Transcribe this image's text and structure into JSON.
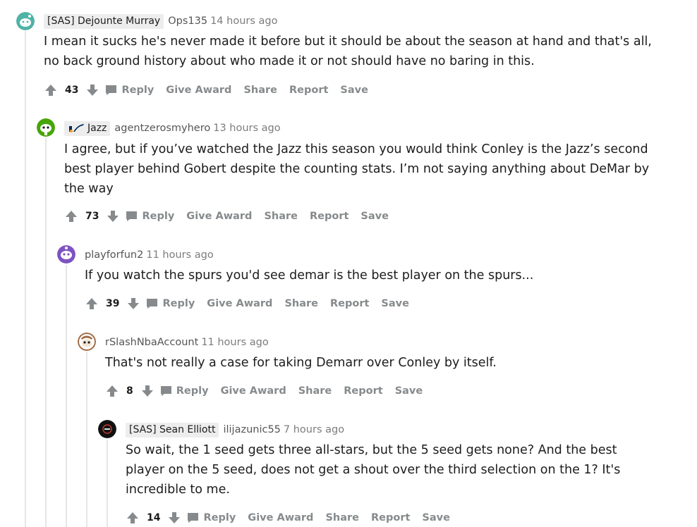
{
  "comments": [
    {
      "flair": "[SAS] Dejounte Murray",
      "username": "Ops135",
      "time": "14 hours ago",
      "body": "I mean it sucks he's never made it before but it should be about the season at hand and that's all, no back ground history about who made it or not should have no baring in this.",
      "score": "43"
    },
    {
      "flair": "Jazz",
      "username": "agentzerosmyhero",
      "time": "13 hours ago",
      "body": "I agree, but if you’ve watched the Jazz this season you would think Conley is the Jazz’s second best player behind Gobert despite the counting stats. I’m not saying anything about DeMar by the way",
      "score": "73"
    },
    {
      "username": "playforfun2",
      "time": "11 hours ago",
      "body": "If you watch the spurs you'd see demar is the best player on the spurs...",
      "score": "39"
    },
    {
      "username": "rSlashNbaAccount",
      "time": "11 hours ago",
      "body": "That's not really a case for taking Demarr over Conley by itself.",
      "score": "8"
    },
    {
      "flair": "[SAS] Sean Elliott",
      "username": "ilijazunic55",
      "time": "7 hours ago",
      "body": "So wait, the 1 seed gets three all-stars, but the 5 seed gets none? And the best player on the 5 seed, does not get a shout over the third selection on the 1? It's incredible to me.",
      "score": "14"
    }
  ],
  "actions": {
    "reply": "Reply",
    "give_award": "Give Award",
    "share": "Share",
    "report": "Report",
    "save": "Save"
  },
  "colors": {
    "action_gray": "#878a8c",
    "thread_line": "#e6e6e6",
    "avatar_teal": "#4fb3a5",
    "avatar_green": "#46a508",
    "avatar_purple": "#7e53c1",
    "avatar_brown": "#a06a42"
  },
  "icons": [
    "upvote-icon",
    "downvote-icon",
    "comment-bubble-icon",
    "snoo-avatar-icon",
    "jazz-note-icon"
  ]
}
